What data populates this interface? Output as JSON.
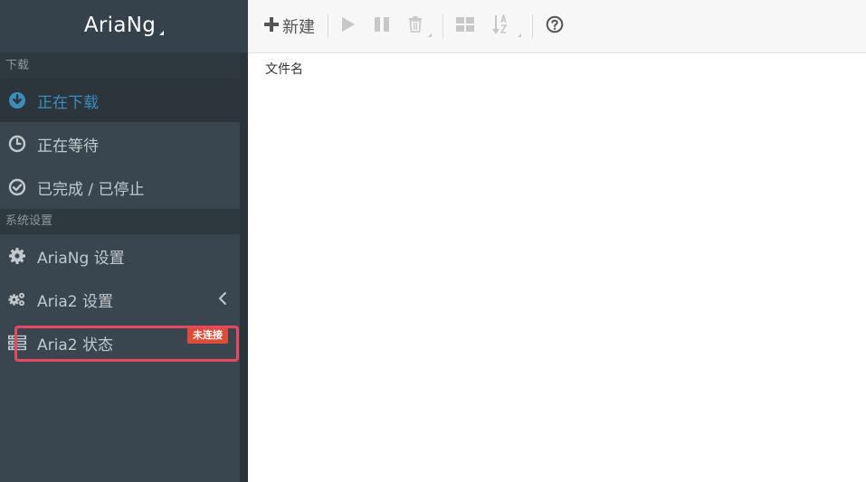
{
  "brand": {
    "title": "AriaNg"
  },
  "sidebar": {
    "sections": [
      {
        "label": "下载"
      },
      {
        "label": "系统设置"
      }
    ],
    "items": [
      {
        "label": "正在下载",
        "icon": "arrow-circle-down-icon",
        "active": true
      },
      {
        "label": "正在等待",
        "icon": "clock-icon"
      },
      {
        "label": "已完成 / 已停止",
        "icon": "check-circle-icon"
      },
      {
        "label": "AriaNg 设置",
        "icon": "gear-icon"
      },
      {
        "label": "Aria2 设置",
        "icon": "gears-icon"
      },
      {
        "label": "Aria2 状态",
        "icon": "server-icon",
        "badge": "未连接"
      }
    ]
  },
  "toolbar": {
    "new_label": "新建",
    "buttons": [
      "plus-icon",
      "play-icon",
      "pause-icon",
      "trash-icon",
      "grid-icon",
      "sort-alpha-icon",
      "help-icon"
    ]
  },
  "main": {
    "column_header": "文件名"
  },
  "colors": {
    "sidebar_bg": "#3a464f",
    "active_text": "#3c8dbc",
    "badge_bg": "#dd4b39",
    "highlight": "#e5485f"
  }
}
